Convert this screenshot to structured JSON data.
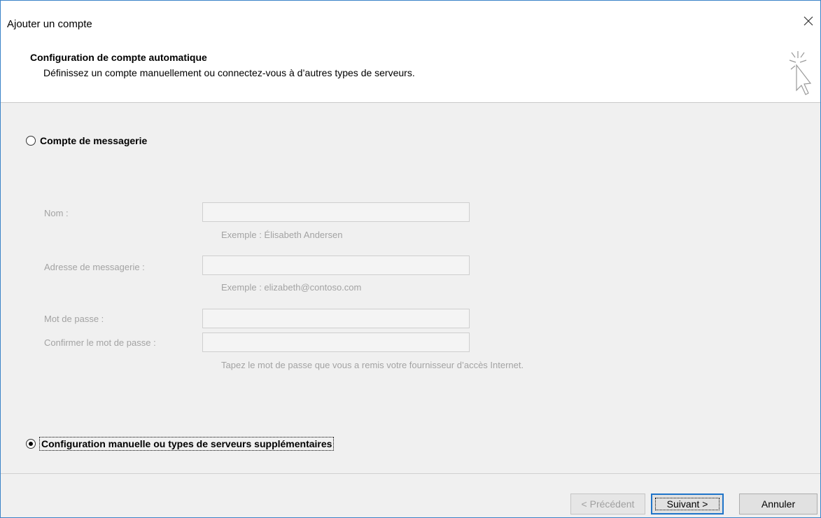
{
  "window": {
    "title": "Ajouter un compte",
    "close_glyph": "✕"
  },
  "header": {
    "title": "Configuration de compte automatique",
    "subtitle": "Définissez un compte manuellement ou connectez-vous à d’autres types de serveurs.",
    "icon": "wizard-cursor-icon"
  },
  "options": {
    "email_account": {
      "label": "Compte de messagerie",
      "checked": false
    },
    "manual": {
      "label": "Configuration manuelle ou types de serveurs supplémentaires",
      "checked": true
    }
  },
  "form": {
    "name_label": "Nom :",
    "name_value": "",
    "name_hint": "Exemple : Élisabeth Andersen",
    "email_label": "Adresse de messagerie :",
    "email_value": "",
    "email_hint": "Exemple : elizabeth@contoso.com",
    "password_label": "Mot de passe :",
    "password_value": "",
    "confirm_label": "Confirmer le mot de passe :",
    "confirm_value": "",
    "password_hint": "Tapez le mot de passe que vous a remis votre fournisseur d’accès Internet."
  },
  "footer": {
    "back_label": "< Précédent",
    "next_label": "Suivant >",
    "cancel_label": "Annuler"
  },
  "colors": {
    "accent": "#3b83c8",
    "disabled_text": "#a3a3a3",
    "panel_bg": "#f0f0f0"
  }
}
